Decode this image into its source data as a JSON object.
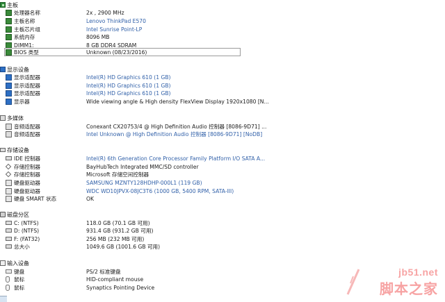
{
  "sections": [
    {
      "title": "主板",
      "icon": "motherboard-icon",
      "items": [
        {
          "label": "处理器名称",
          "value": "2x , 2900 MHz",
          "icon": "board-chip-icon",
          "blue": false
        },
        {
          "label": "主板名称",
          "value": "Lenovo ThinkPad E570",
          "icon": "board-chip-icon",
          "blue": true
        },
        {
          "label": "主板芯片组",
          "value": "Intel Sunrise Point-LP",
          "icon": "board-chip-icon",
          "blue": true
        },
        {
          "label": "系统内存",
          "value": "8096 MB",
          "icon": "board-chip-icon",
          "blue": false
        },
        {
          "label": "DIMM1:",
          "value": "8 GB  DDR4 SDRAM",
          "icon": "memory-icon",
          "blue": false
        },
        {
          "label": "BIOS 类型",
          "value": "Unknown (08/23/2016)",
          "icon": "bios-icon",
          "blue": false,
          "selected": true
        }
      ]
    },
    {
      "title": "显示设备",
      "icon": "display-icon",
      "items": [
        {
          "label": "显示适配器",
          "value": "Intel(R) HD Graphics 610  (1 GB)",
          "icon": "display-adapter-icon",
          "blue": true
        },
        {
          "label": "显示适配器",
          "value": "Intel(R) HD Graphics 610  (1 GB)",
          "icon": "display-adapter-icon",
          "blue": true
        },
        {
          "label": "显示适配器",
          "value": "Intel(R) HD Graphics 610  (1 GB)",
          "icon": "display-adapter-icon",
          "blue": true
        },
        {
          "label": "显示器",
          "value": "Wide viewing angle & High density FlexView Display 1920x1080 [N...",
          "icon": "monitor-icon",
          "blue": false
        }
      ]
    },
    {
      "title": "多媒体",
      "icon": "multimedia-icon",
      "items": [
        {
          "label": "音频适配器",
          "value": "Conexant CX20753/4 @ High Definition Audio 控制器 [8086-9D71] ...",
          "icon": "speaker-icon",
          "blue": false
        },
        {
          "label": "音频适配器",
          "value": "Intel Unknown @ High Definition Audio 控制器 [8086-9D71] [NoDB]",
          "icon": "speaker-icon",
          "blue": true
        }
      ]
    },
    {
      "title": "存储设备",
      "icon": "storage-icon",
      "items": [
        {
          "label": "IDE 控制器",
          "value": "Intel(R) 6th Generation Core Processor Family Platform I/O SATA A...",
          "icon": "ide-controller-icon",
          "blue": true
        },
        {
          "label": "存储控制器",
          "value": "BayHubTech Integrated MMC/SD controller",
          "icon": "storage-controller-icon",
          "blue": false
        },
        {
          "label": "存储控制器",
          "value": "Microsoft 存储空间控制器",
          "icon": "storage-controller-icon",
          "blue": false
        },
        {
          "label": "硬盘驱动器",
          "value": "SAMSUNG MZNTY128HDHP-000L1  (119 GB)",
          "icon": "hard-drive-icon",
          "blue": true
        },
        {
          "label": "硬盘驱动器",
          "value": "WDC WD10JPVX-08JC3T6  (1000 GB, 5400 RPM, SATA-III)",
          "icon": "hard-drive-icon",
          "blue": true
        },
        {
          "label": "硬盘 SMART 状态",
          "value": "OK",
          "icon": "smart-status-icon",
          "blue": false
        }
      ]
    },
    {
      "title": "磁盘分区",
      "icon": "partition-icon",
      "items": [
        {
          "label": "C: (NTFS)",
          "value": "118.0 GB (70.1 GB 可用)",
          "icon": "drive-c-icon",
          "blue": false
        },
        {
          "label": "D: (NTFS)",
          "value": "931.4 GB (931.2 GB 可用)",
          "icon": "drive-d-icon",
          "blue": false
        },
        {
          "label": "F: (FAT32)",
          "value": "256 MB (232 MB 可用)",
          "icon": "drive-f-icon",
          "blue": false
        },
        {
          "label": "总大小",
          "value": "1049.6 GB (1001.6 GB 可用)",
          "icon": "total-size-icon",
          "blue": false
        }
      ]
    },
    {
      "title": "输入设备",
      "icon": "input-device-icon",
      "items": [
        {
          "label": "键盘",
          "value": "PS/2 标准键盘",
          "icon": "keyboard-icon",
          "blue": false
        },
        {
          "label": "鼠标",
          "value": "HID-compliant mouse",
          "icon": "mouse-icon",
          "blue": false
        },
        {
          "label": "鼠标",
          "value": "Synaptics Pointing Device",
          "icon": "mouse-icon",
          "blue": false
        }
      ]
    }
  ],
  "watermark": {
    "url": "jb51.net",
    "name": "脚本之家"
  },
  "colors": {
    "link_blue": "#2f5fa8",
    "watermark": "#f7a3a3"
  }
}
